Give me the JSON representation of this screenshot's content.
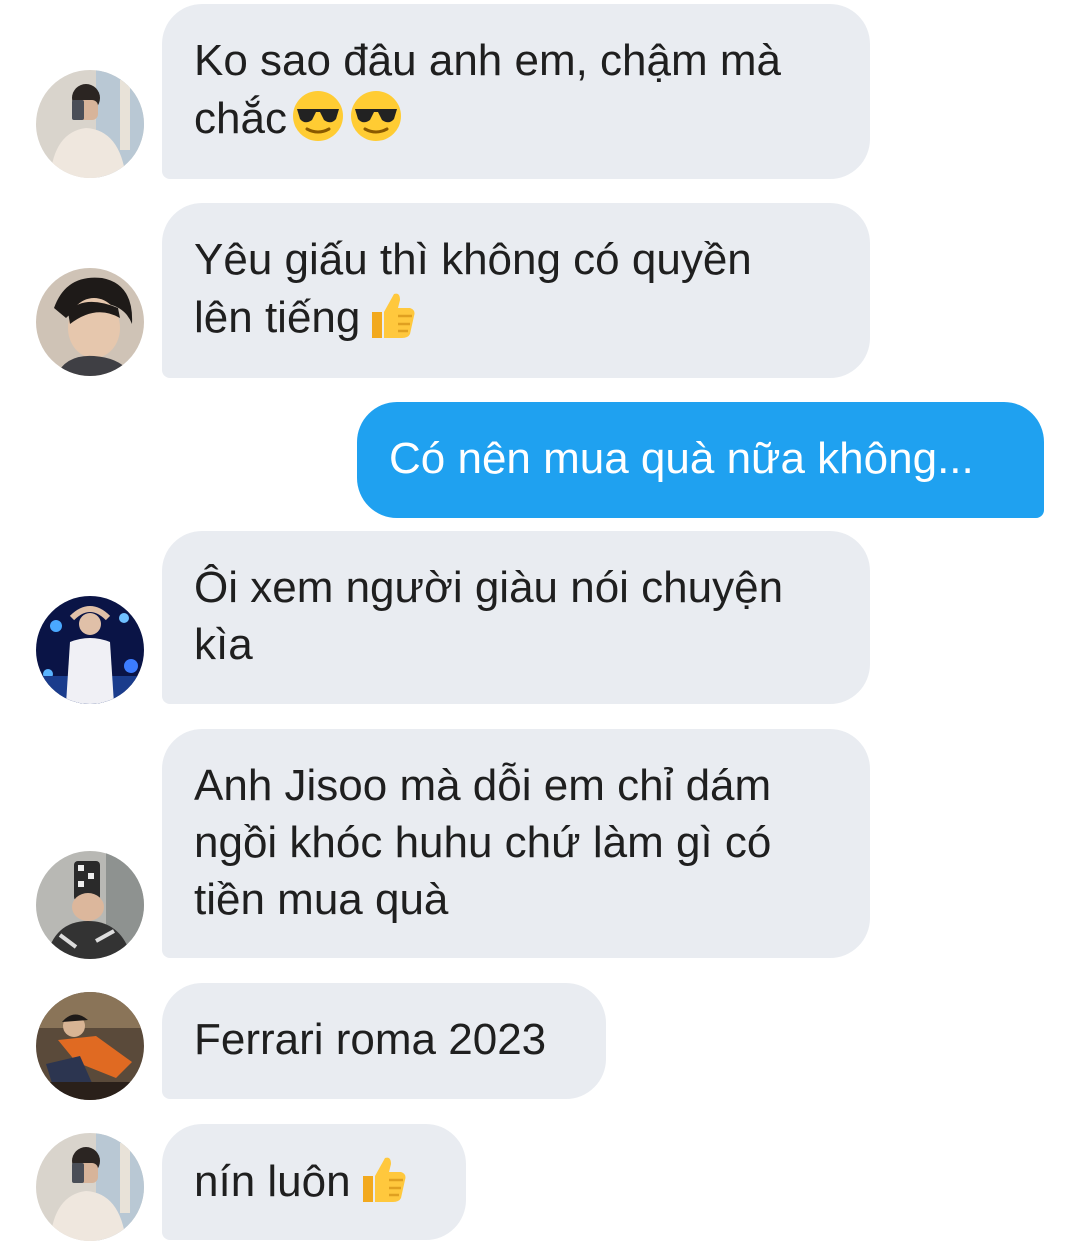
{
  "conversation": {
    "messages": [
      {
        "side": "incoming",
        "text": "Ko sao đâu anh em, chậm mà\nchắc",
        "emojis": [
          "sunglasses-face",
          "sunglasses-face"
        ]
      },
      {
        "side": "incoming",
        "text": "Yêu giấu thì không có quyền\nlên tiếng",
        "emojis": [
          "thumbs-up"
        ]
      },
      {
        "side": "outgoing",
        "text": "Có nên mua quà nữa không..."
      },
      {
        "side": "incoming",
        "text": "Ôi xem người giàu nói chuyện\nkìa",
        "emojis": []
      },
      {
        "side": "incoming",
        "text": "Anh Jisoo mà dỗi em chỉ dám\nngồi khóc huhu chứ làm gì có\ntiền mua quà",
        "emojis": []
      },
      {
        "side": "incoming",
        "text": "Ferrari roma 2023",
        "emojis": []
      },
      {
        "side": "incoming",
        "text": "nín luôn",
        "emojis": [
          "thumbs-up"
        ]
      }
    ]
  },
  "colors": {
    "incoming_bubble": "#e9ecf1",
    "outgoing_bubble": "#1fa1f0",
    "text_dark": "#1f1f1f",
    "text_light": "#ffffff"
  }
}
